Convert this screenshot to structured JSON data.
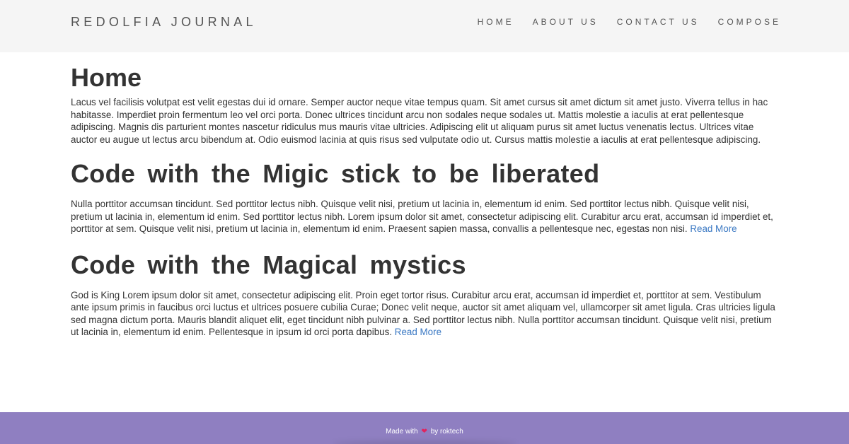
{
  "header": {
    "brand": "REDOLFIA JOURNAL",
    "nav": [
      "HOME",
      "ABOUT US",
      "CONTACT US",
      "COMPOSE"
    ]
  },
  "page": {
    "title": "Home",
    "intro": "Lacus vel facilisis volutpat est velit egestas dui id ornare. Semper auctor neque vitae tempus quam. Sit amet cursus sit amet dictum sit amet justo. Viverra tellus in hac habitasse. Imperdiet proin fermentum leo vel orci porta. Donec ultrices tincidunt arcu non sodales neque sodales ut. Mattis molestie a iaculis at erat pellentesque adipiscing. Magnis dis parturient montes nascetur ridiculus mus mauris vitae ultricies. Adipiscing elit ut aliquam purus sit amet luctus venenatis lectus. Ultrices vitae auctor eu augue ut lectus arcu bibendum at. Odio euismod lacinia at quis risus sed vulputate odio ut. Cursus mattis molestie a iaculis at erat pellentesque adipiscing."
  },
  "posts": [
    {
      "title": "Code with the Migic stick to be liberated",
      "excerpt": "Nulla porttitor accumsan tincidunt. Sed porttitor lectus nibh. Quisque velit nisi, pretium ut lacinia in, elementum id enim. Sed porttitor lectus nibh. Quisque velit nisi, pretium ut lacinia in, elementum id enim. Sed porttitor lectus nibh. Lorem ipsum dolor sit amet, consectetur adipiscing elit. Curabitur arcu erat, accumsan id imperdiet et, porttitor at sem. Quisque velit nisi, pretium ut lacinia in, elementum id enim. Praesent sapien massa, convallis a pellentesque nec, egestas non nisi.",
      "read_more": "Read More"
    },
    {
      "title": "Code with the Magical mystics",
      "excerpt": "God is King Lorem ipsum dolor sit amet, consectetur adipiscing elit. Proin eget tortor risus. Curabitur arcu erat, accumsan id imperdiet et, porttitor at sem. Vestibulum ante ipsum primis in faucibus orci luctus et ultrices posuere cubilia Curae; Donec velit neque, auctor sit amet aliquam vel, ullamcorper sit amet ligula. Cras ultricies ligula sed magna dictum porta. Mauris blandit aliquet elit, eget tincidunt nibh pulvinar a. Sed porttitor lectus nibh. Nulla porttitor accumsan tincidunt. Quisque velit nisi, pretium ut lacinia in, elementum id enim. Pellentesque in ipsum id orci porta dapibus.",
      "read_more": "Read More"
    }
  ],
  "footer": {
    "prefix": "Made with",
    "heart": "❤",
    "suffix": "by roktech",
    "icon": "heart-icon",
    "accent_color": "#8f7fc1"
  }
}
